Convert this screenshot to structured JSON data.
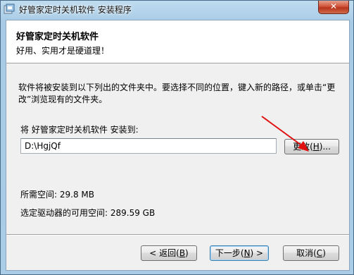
{
  "window": {
    "title": "好管家定时关机软件 安装程序",
    "close_label": "✕"
  },
  "header": {
    "title": "好管家定时关机软件",
    "subtitle": "好用、实用才是硬道理！"
  },
  "body": {
    "description": "软件将被安装到以下列出的文件夹中。要选择不同的位置，键入新的路径，或单击“更改”浏览现有的文件夹。",
    "install_to_label": "将 好管家定时关机软件 安装到:",
    "path_value": "D:\\HgjQf",
    "change_button": {
      "label": "更改(",
      "mnemonic": "H",
      "suffix": ")..."
    },
    "space_required": "所需空间: 29.8 MB",
    "space_available": "选定驱动器的可用空间: 289.59 GB"
  },
  "footer": {
    "back_button": {
      "label": "< 返回(",
      "mnemonic": "B",
      "suffix": ")"
    },
    "next_button": {
      "label": "下一步(",
      "mnemonic": "N",
      "suffix": ") >"
    },
    "cancel_button": {
      "label": "取消(",
      "mnemonic": "C",
      "suffix": ")"
    }
  },
  "colors": {
    "annotation_arrow": "#e01010",
    "title_bar": "#a9cde7"
  }
}
